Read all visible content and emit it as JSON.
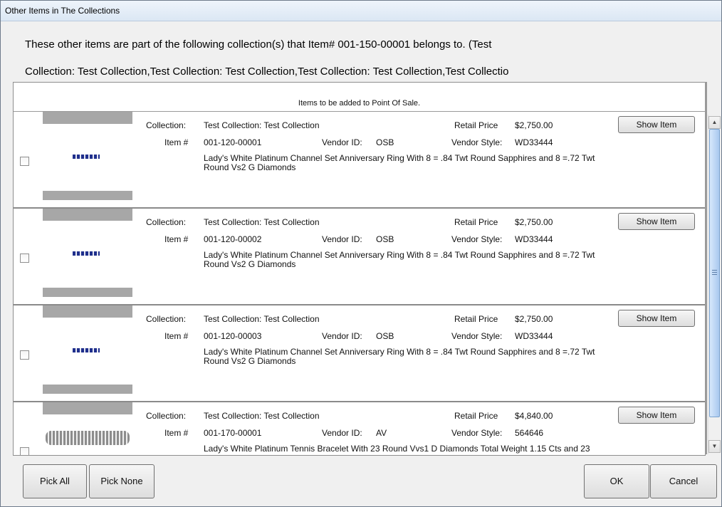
{
  "window": {
    "title": "Other Items in The Collections"
  },
  "header": {
    "message_line1": "These other items are part of the following collection(s) that Item# 001-150-00001 belongs to. (Test",
    "message_line2": "Collection: Test Collection,Test Collection: Test Collection,Test Collection: Test Collection,Test Collectio"
  },
  "list": {
    "header_text": "Items to be added to Point Of Sale.",
    "labels": {
      "collection": "Collection:",
      "item": "Item #",
      "vendor_id": "Vendor ID:",
      "retail_price": "Retail Price",
      "vendor_style": "Vendor Style:",
      "show_item": "Show Item"
    },
    "rows": [
      {
        "collection": "Test Collection: Test Collection",
        "item_no": "001-120-00001",
        "vendor_id": "OSB",
        "retail_price": "$2,750.00",
        "vendor_style": "WD33444",
        "description_line1": "Lady's White Platinum Channel Set Anniversary Ring With 8 = .84 Twt Round  Sapphires and 8 =.72 Twt",
        "description_line2": "Round Vs2 G Diamonds",
        "thumb": "ring",
        "checked": false
      },
      {
        "collection": "Test Collection: Test Collection",
        "item_no": "001-120-00002",
        "vendor_id": "OSB",
        "retail_price": "$2,750.00",
        "vendor_style": "WD33444",
        "description_line1": "Lady's White Platinum Channel Set Anniversary Ring With 8 = .84 Twt Round  Sapphires and 8 =.72 Twt",
        "description_line2": "Round Vs2 G Diamonds",
        "thumb": "ring",
        "checked": false
      },
      {
        "collection": "Test Collection: Test Collection",
        "item_no": "001-120-00003",
        "vendor_id": "OSB",
        "retail_price": "$2,750.00",
        "vendor_style": "WD33444",
        "description_line1": "Lady's White Platinum Channel Set Anniversary Ring With 8 = .84 Twt Round  Sapphires and 8 =.72 Twt",
        "description_line2": "Round Vs2 G Diamonds",
        "thumb": "ring",
        "checked": false
      },
      {
        "collection": "Test Collection: Test Collection",
        "item_no": "001-170-00001",
        "vendor_id": "AV",
        "retail_price": "$4,840.00",
        "vendor_style": "564646",
        "description_line1": "Lady's White Platinum Tennis Bracelet With 23 Round Vvs1 D Diamonds Total Weight 1.15 Cts and 23",
        "description_line2": "",
        "thumb": "bracelet",
        "checked": false
      }
    ]
  },
  "buttons": {
    "pick_all": "Pick All",
    "pick_none": "Pick None",
    "ok": "OK",
    "cancel": "Cancel"
  },
  "icons": {
    "scroll_up": "scroll-up-arrow-icon",
    "scroll_down": "scroll-down-arrow-icon",
    "grip": "scroll-grip-icon"
  }
}
